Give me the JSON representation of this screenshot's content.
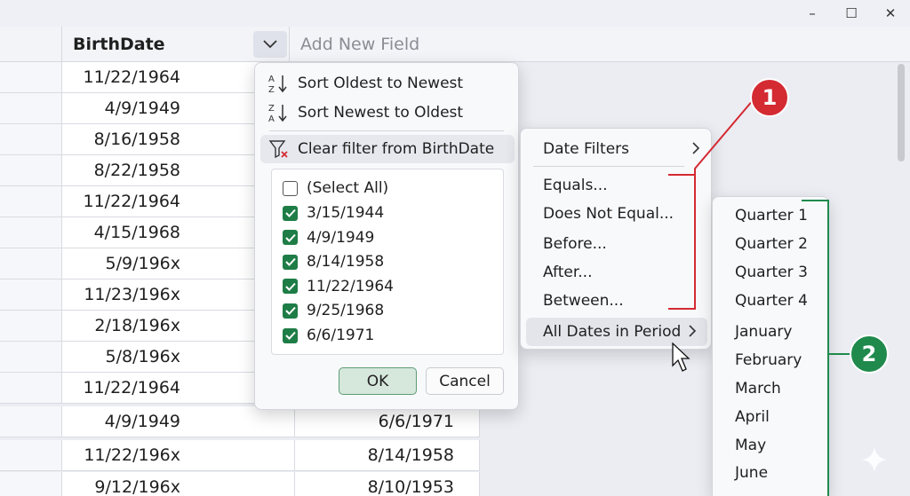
{
  "window": {
    "minimize_glyph": "–",
    "maximize_glyph": "☐",
    "close_glyph": "✕"
  },
  "header": {
    "birthdate_label": "BirthDate",
    "add_field_label": "Add New Field"
  },
  "grid": {
    "rows": [
      {
        "birthdate": "11/22/1964",
        "other": ""
      },
      {
        "birthdate": "4/9/1949",
        "other": ""
      },
      {
        "birthdate": "8/16/1958",
        "other": ""
      },
      {
        "birthdate": "8/22/1958",
        "other": ""
      },
      {
        "birthdate": "11/22/1964",
        "other": ""
      },
      {
        "birthdate": "4/15/1968",
        "other": ""
      },
      {
        "birthdate": "5/9/196x",
        "other": ""
      },
      {
        "birthdate": "11/23/196x",
        "other": ""
      },
      {
        "birthdate": "2/18/196x",
        "other": ""
      },
      {
        "birthdate": "5/8/196x",
        "other": ""
      },
      {
        "birthdate": "11/22/1964",
        "other": ""
      },
      {
        "birthdate": "4/9/1949",
        "other": "6/6/1971"
      },
      {
        "birthdate": "11/22/196x",
        "other": "8/14/1958"
      },
      {
        "birthdate": "9/12/196x",
        "other": "8/10/1953"
      }
    ]
  },
  "filter_menu": {
    "sort_asc": "Sort Oldest to Newest",
    "sort_desc": "Sort Newest to Oldest",
    "clear_filter": "Clear filter from BirthDate",
    "select_all": "(Select All)",
    "values": [
      "3/15/1944",
      "4/9/1949",
      "8/14/1958",
      "11/22/1964",
      "9/25/1968",
      "6/6/1971"
    ],
    "ok": "OK",
    "cancel": "Cancel"
  },
  "date_filters_menu": {
    "date_filters": "Date Filters",
    "equals": "Equals...",
    "not_equal": "Does Not Equal...",
    "before": "Before...",
    "after": "After...",
    "between": "Between...",
    "all_dates_in_period": "All Dates in Period"
  },
  "period_menu": {
    "items": [
      "Quarter 1",
      "Quarter 2",
      "Quarter 3",
      "Quarter 4",
      "January",
      "February",
      "March",
      "April",
      "May",
      "June"
    ]
  },
  "callouts": {
    "one": "1",
    "two": "2",
    "red": "#d42a32",
    "green": "#1f8a4c"
  },
  "colors": {
    "checkbox": "#1e7d46",
    "ok_border": "#5f9c75"
  }
}
